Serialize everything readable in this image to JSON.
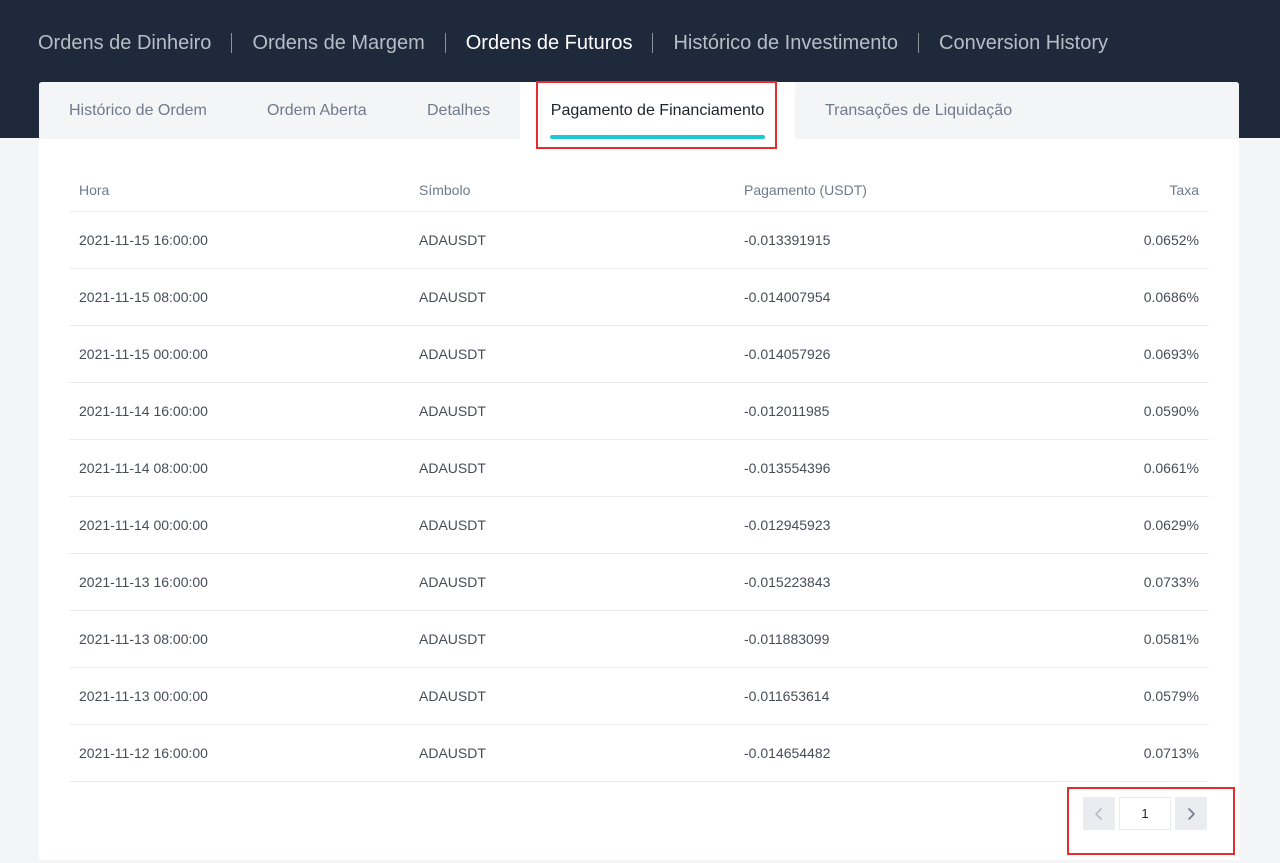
{
  "main_nav": {
    "items": [
      {
        "label": "Ordens de Dinheiro"
      },
      {
        "label": "Ordens de Margem"
      },
      {
        "label": "Ordens de Futuros"
      },
      {
        "label": "Histórico de Investimento"
      },
      {
        "label": "Conversion History"
      }
    ],
    "active": "Ordens de Futuros"
  },
  "sub_tabs": {
    "items": [
      {
        "label": "Histórico de Ordem"
      },
      {
        "label": "Ordem Aberta"
      },
      {
        "label": "Detalhes"
      },
      {
        "label": "Pagamento de Financiamento"
      },
      {
        "label": "Transações de Liquidação"
      }
    ],
    "active": "Pagamento de Financiamento"
  },
  "table": {
    "headers": {
      "time": "Hora",
      "symbol": "Símbolo",
      "payment": "Pagamento (USDT)",
      "rate": "Taxa"
    },
    "rows": [
      {
        "time": "2021-11-15 16:00:00",
        "symbol": "ADAUSDT",
        "payment": "-0.013391915",
        "rate": "0.0652%"
      },
      {
        "time": "2021-11-15 08:00:00",
        "symbol": "ADAUSDT",
        "payment": "-0.014007954",
        "rate": "0.0686%"
      },
      {
        "time": "2021-11-15 00:00:00",
        "symbol": "ADAUSDT",
        "payment": "-0.014057926",
        "rate": "0.0693%"
      },
      {
        "time": "2021-11-14 16:00:00",
        "symbol": "ADAUSDT",
        "payment": "-0.012011985",
        "rate": "0.0590%"
      },
      {
        "time": "2021-11-14 08:00:00",
        "symbol": "ADAUSDT",
        "payment": "-0.013554396",
        "rate": "0.0661%"
      },
      {
        "time": "2021-11-14 00:00:00",
        "symbol": "ADAUSDT",
        "payment": "-0.012945923",
        "rate": "0.0629%"
      },
      {
        "time": "2021-11-13 16:00:00",
        "symbol": "ADAUSDT",
        "payment": "-0.015223843",
        "rate": "0.0733%"
      },
      {
        "time": "2021-11-13 08:00:00",
        "symbol": "ADAUSDT",
        "payment": "-0.011883099",
        "rate": "0.0581%"
      },
      {
        "time": "2021-11-13 00:00:00",
        "symbol": "ADAUSDT",
        "payment": "-0.011653614",
        "rate": "0.0579%"
      },
      {
        "time": "2021-11-12 16:00:00",
        "symbol": "ADAUSDT",
        "payment": "-0.014654482",
        "rate": "0.0713%"
      }
    ]
  },
  "pagination": {
    "current_page": "1",
    "prev_icon": "chevron-left-icon",
    "next_icon": "chevron-right-icon"
  },
  "colors": {
    "header_bg": "#1e293b",
    "accent": "#1fc7d4",
    "highlight": "#e52d2d"
  }
}
